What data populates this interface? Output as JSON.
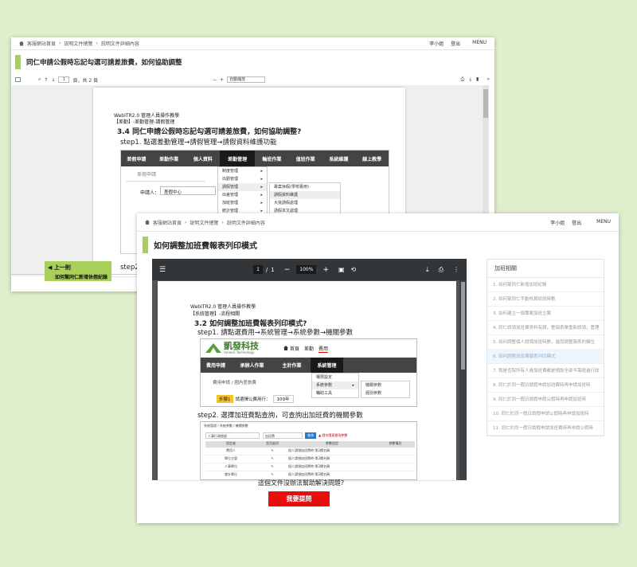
{
  "win1": {
    "breadcrumb": [
      "客服網站首頁",
      "説明文件總覽",
      "説明文件詳細內容"
    ],
    "user": "李小姐",
    "logout": "登出",
    "menu": "MENU",
    "title": "同仁申請公假時忘記勾選可請差旅費，如何協助調整",
    "toolbar": {
      "page_value": "1",
      "page_total": "頁，共 2 頁",
      "zoom_select": "自動縮放"
    },
    "doc": {
      "header1": "WebITR2.0 管理人員操作教學",
      "header2": "【差勤】-差勤管理-請假管理",
      "heading": "3.4  同仁申請公假時忘記勾選可請差旅費，如何協助調整?",
      "step1": "step1.   點選差勤管理→請假管理→請假資料維護功能",
      "nav": [
        "差假申請",
        "差勤作業",
        "個人資料",
        "差勤管理",
        "輪班作業",
        "值班作業",
        "系統維護",
        "線上教學"
      ],
      "sub_title": "差假申請",
      "applicant_label": "申請人：",
      "applicant_value": "差假中心",
      "dropdown1": [
        "制度管理",
        "出勤管理",
        "請假管理",
        "出差管理",
        "加班管理",
        "統計管理"
      ],
      "dropdown2": [
        "專案休假(學校專用)",
        "請假資料維護",
        "大批請假處理",
        "請假本文處理"
      ],
      "step2_cut": "step2"
    },
    "prev": {
      "label": "上一則",
      "sub": "如何幫同仁新增休假紀錄"
    }
  },
  "win2": {
    "breadcrumb": [
      "客服網站首頁",
      "說明文件總覽",
      "說明文件詳細內容"
    ],
    "user": "李小姐",
    "logout": "登出",
    "menu": "MENU",
    "title": "如何調整加班費報表列印模式",
    "pdf": {
      "page_current": "1",
      "page_sep": "/",
      "page_total": "1",
      "zoom": "100%"
    },
    "doc": {
      "header1": "WebITR2.0 管理人員操作教學",
      "header2": "【系統管理】-流程相關",
      "heading": "3.2  如何調整加班費報表列印模式?",
      "step1": "step1.   請點選費用→系統管理→系統參數→機關參數",
      "logo_cn": "凱發科技",
      "logo_en": "UnionG Technology",
      "logo_nav": [
        "首頁",
        "差勤",
        "費用"
      ],
      "nav": [
        "費用申請",
        "承辦人作業",
        "主計作業",
        "系統管理"
      ],
      "sub_path": "費用申請 / 國內差旅費",
      "dd1": [
        "權限設定",
        "系統參數",
        "輔助工具"
      ],
      "dd2": [
        "機關參數",
        "經別參數"
      ],
      "step_badge": "步驟1",
      "row_label": "請選擇公費用行：",
      "row_value": "109年",
      "step2": "step2.   選擇加班費點查詢，可查詢出加班費的機關參數",
      "table": {
        "crumb": "系統管理 / 系統參數 / 機關參數",
        "select1": "人事行政總處",
        "select2": "加班費",
        "query_btn": "查詢",
        "warn": "請勿隨意更改參數",
        "headers": [
          "設定者",
          "是否啟用",
          "參數設定",
          "參數備註"
        ],
        "rows": [
          [
            "費用人",
            "個人請領加班費時-第2欄名稱"
          ],
          [
            "單位主管",
            "個人請領加班費時-第2欄名稱"
          ],
          [
            "人事單位",
            "個人請領加班費時-第2欄名稱"
          ],
          [
            "會計單位",
            "個人請領加班費時-第2欄名稱"
          ]
        ]
      }
    },
    "help_question": "這個文件沒辦法幫助解決問題?",
    "ask_button": "我要提問",
    "related": {
      "title": "加班相關",
      "items": [
        "1. 如何幫同仁新增加班紀錄",
        "2. 如何幫同仁手動核算加班時數",
        "3. 如何建立一個專案加班立案",
        "4. 同仁請領加班費資料有誤，整個表單重新請領，管理",
        "5. 如何調整個人請領加班時數，進而調整報表的欄位",
        "6. 如何調整加班費報表列印模式",
        "7. 我是否院所有人員加班費都是預設全部不需經過行政",
        "8. 同仁於同一假日請假申請加班費時再申請加班時",
        "9. 同仁於同一假日請假申請公假時再申請加班時",
        "10. 同仁於同一假日請假申請公假時再申請加班時",
        "11. 同仁於同一假日請假申請加班費時再申請公假時"
      ],
      "highlight_index": 5
    }
  }
}
